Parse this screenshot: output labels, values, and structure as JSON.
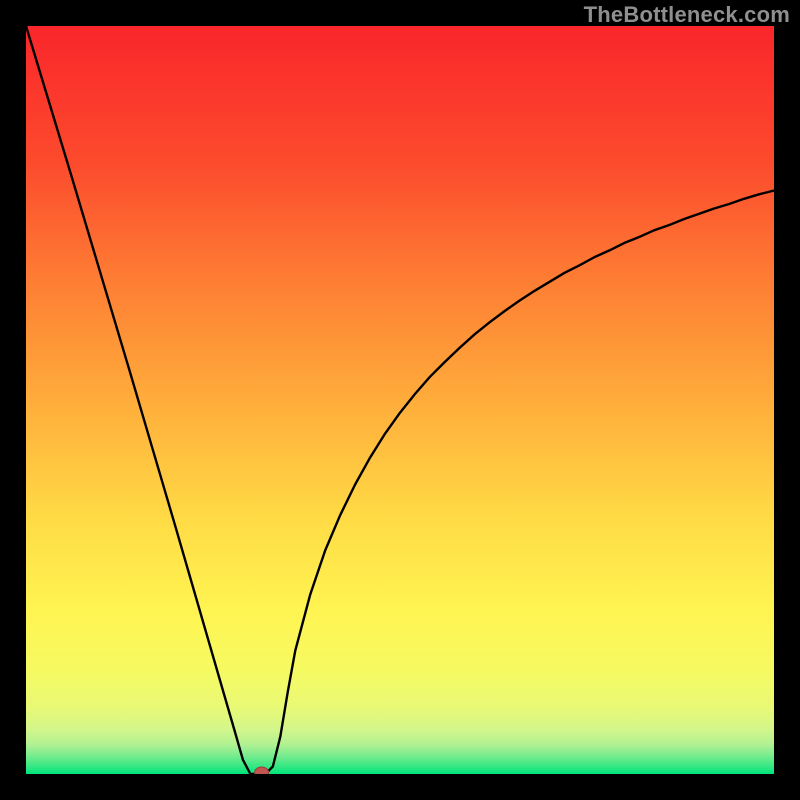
{
  "watermark": "TheBottleneck.com",
  "chart_data": {
    "type": "line",
    "title": "",
    "xlabel": "",
    "ylabel": "",
    "xlim": [
      0,
      100
    ],
    "ylim": [
      0,
      100
    ],
    "grid": false,
    "x": [
      0,
      2,
      4,
      6,
      8,
      10,
      12,
      14,
      16,
      18,
      20,
      22,
      24,
      26,
      28,
      29,
      30,
      31,
      32,
      33,
      34,
      35,
      36,
      38,
      40,
      42,
      44,
      46,
      48,
      50,
      52,
      54,
      56,
      58,
      60,
      62,
      64,
      66,
      68,
      70,
      72,
      74,
      76,
      78,
      80,
      82,
      84,
      86,
      88,
      90,
      92,
      94,
      96,
      98,
      100
    ],
    "y": [
      100,
      93.4,
      86.8,
      80.2,
      73.5,
      66.8,
      60.1,
      53.4,
      46.6,
      39.8,
      33.0,
      26.1,
      19.2,
      12.3,
      5.4,
      1.9,
      0.0,
      0.0,
      0.0,
      1.0,
      5.0,
      11.0,
      16.5,
      24.0,
      29.9,
      34.6,
      38.7,
      42.3,
      45.5,
      48.3,
      50.8,
      53.1,
      55.1,
      57.0,
      58.8,
      60.4,
      61.9,
      63.3,
      64.6,
      65.8,
      67.0,
      68.0,
      69.1,
      70.0,
      71.0,
      71.8,
      72.7,
      73.4,
      74.2,
      74.9,
      75.6,
      76.2,
      76.9,
      77.5,
      78.0
    ],
    "minimum_marker": {
      "x": 31.5,
      "y": 0.2
    },
    "background": "rainbow-vertical",
    "background_colors_top_to_bottom": [
      "#fa262b",
      "#fd6530",
      "#ffa83a",
      "#ffe448",
      "#f9fa5b",
      "#e5f978",
      "#00e47a"
    ]
  }
}
